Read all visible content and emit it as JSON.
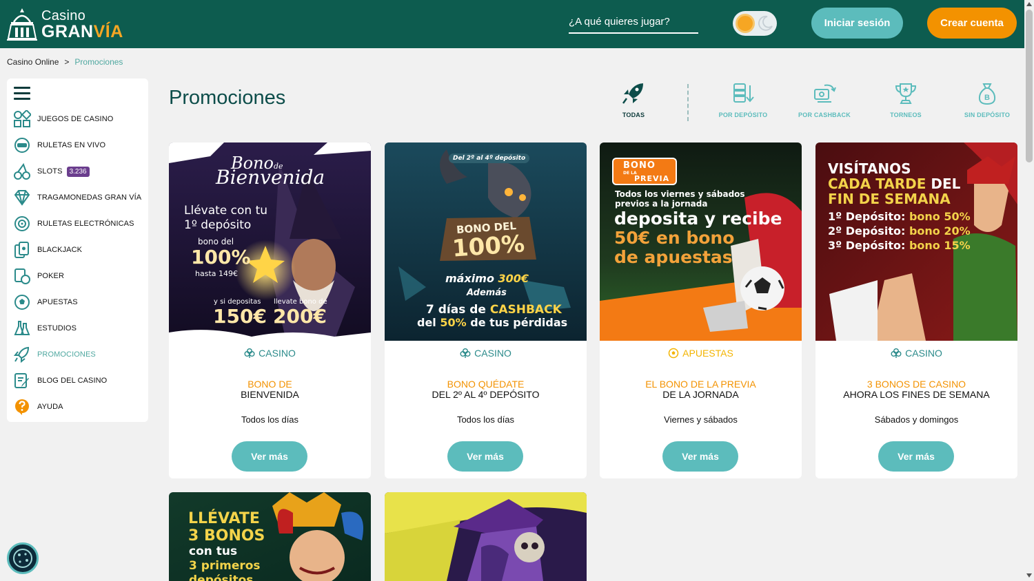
{
  "header": {
    "logo_top": "Casino",
    "logo_bottom_a": "GRAN",
    "logo_bottom_b": "VÍA",
    "search_placeholder": "¿A qué quieres jugar?",
    "login_label": "Iniciar sesión",
    "register_label": "Crear cuenta"
  },
  "breadcrumb": {
    "home": "Casino Online",
    "separator": ">",
    "current": "Promociones"
  },
  "sidebar": {
    "items": [
      {
        "label": "JUEGOS DE CASINO",
        "icon": "games-grid-icon"
      },
      {
        "label": "RULETAS EN VIVO",
        "icon": "live-roulette-icon"
      },
      {
        "label": "SLOTS",
        "icon": "cherries-icon",
        "badge": "3.236"
      },
      {
        "label": "TRAGAMONEDAS GRAN VÍA",
        "icon": "diamond-icon"
      },
      {
        "label": "RULETAS ELECTRÓNICAS",
        "icon": "roulette-icon"
      },
      {
        "label": "BLACKJACK",
        "icon": "cards-icon"
      },
      {
        "label": "POKER",
        "icon": "poker-chip-icon"
      },
      {
        "label": "APUESTAS",
        "icon": "soccer-ball-icon"
      },
      {
        "label": "ESTUDIOS",
        "icon": "lab-flask-icon"
      },
      {
        "label": "PROMOCIONES",
        "icon": "rocket-icon",
        "active": true
      },
      {
        "label": "BLOG DEL CASINO",
        "icon": "blog-edit-icon"
      },
      {
        "label": "AYUDA",
        "icon": "help-icon"
      }
    ]
  },
  "page": {
    "title": "Promociones"
  },
  "filters": [
    {
      "label": "TODAS",
      "icon": "rocket-icon",
      "active": true
    },
    {
      "label": "POR DEPÓSITO",
      "icon": "deposit-icon"
    },
    {
      "label": "POR CASHBACK",
      "icon": "cashback-icon"
    },
    {
      "label": "TORNEOS",
      "icon": "trophy-icon"
    },
    {
      "label": "SIN DEPÓSITO",
      "icon": "money-bag-icon"
    }
  ],
  "cards": [
    {
      "category": "CASINO",
      "title_orange": "BONO DE",
      "title_black": "BIENVENIDA",
      "when": "Todos los días",
      "button": "Ver más",
      "img": {
        "line1": "Bono",
        "line1_small": "de",
        "line2": "Bienvenida",
        "line3": "Llévate con tu",
        "line4": "1º depósito",
        "line5": "bono del",
        "line6": "100%",
        "line7": "hasta 149€",
        "line8": "y si depositas",
        "line9": "llevate bono de",
        "line10": "150€",
        "line11": "200€"
      }
    },
    {
      "category": "CASINO",
      "title_orange": "BONO QUÉDATE",
      "title_black": "DEL 2º AL 4º DEPÓSITO",
      "when": "Todos los días",
      "button": "Ver más",
      "img": {
        "tag": "Del 2º al 4º depósito",
        "line1": "BONO DEL",
        "line2": "100%",
        "line3a": "máximo",
        "line3b": "300€",
        "line4": "Además",
        "line5a": "7 días de",
        "line5b": "CASHBACK",
        "line6a": "del",
        "line6b": "50%",
        "line6c": "de tus pérdidas"
      }
    },
    {
      "category": "APUESTAS",
      "title_orange": "EL BONO DE LA PREVIA",
      "title_black": "DE LA JORNADA",
      "when": "Viernes y sábados",
      "button": "Ver más",
      "img": {
        "badge1": "BONO",
        "badge2": "DE LA",
        "badge3": "PREVIA",
        "line1": "Todos los viernes y sábados",
        "line2": "previos a la jornada",
        "line3": "deposita y recibe",
        "line4": "50€ en bono",
        "line5": "de apuestas"
      }
    },
    {
      "category": "CASINO",
      "title_orange": "3 BONOS DE CASINO",
      "title_black": "AHORA LOS FINES DE SEMANA",
      "when": "Sábados y domingos",
      "button": "Ver más",
      "img": {
        "line1": "VISÍTANOS",
        "line2a": "CADA TARDE",
        "line2b": "DEL",
        "line3": "FIN DE SEMANA",
        "d1a": "1º Depósito:",
        "d1b": "bono 50%",
        "d2a": "2º Depósito:",
        "d2b": "bono 20%",
        "d3a": "3º Depósito:",
        "d3b": "bono 15%"
      }
    },
    {
      "img": {
        "line1": "LLÉVATE",
        "line2": "3 BONOS",
        "line3": "con tus",
        "line4": "3 primeros",
        "line5": "depósitos"
      }
    },
    {
      "img": {}
    }
  ],
  "colors": {
    "header_bg": "#0d5c4f",
    "teal_button": "#5cbcbc",
    "orange_button": "#f39200",
    "title_color": "#0d4d4a"
  }
}
